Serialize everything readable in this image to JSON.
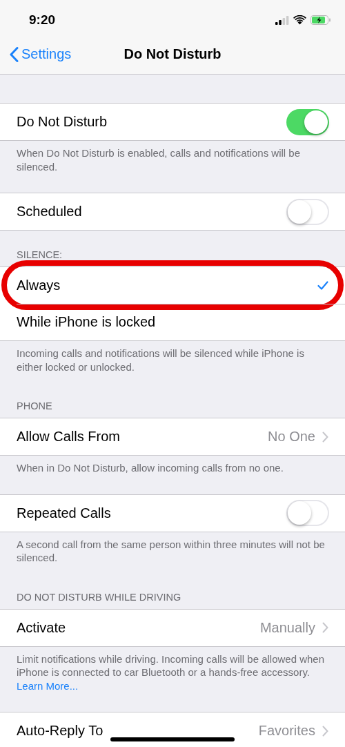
{
  "status_bar": {
    "time": "9:20"
  },
  "nav": {
    "back": "Settings",
    "title": "Do Not Disturb"
  },
  "sections": [
    {
      "rows": [
        {
          "kind": "toggle",
          "label": "Do Not Disturb",
          "on": true
        }
      ],
      "footer": {
        "text": "When Do Not Disturb is enabled, calls and notifications will be silenced."
      }
    },
    {
      "rows": [
        {
          "kind": "toggle",
          "label": "Scheduled",
          "on": false
        }
      ]
    },
    {
      "header": "SILENCE:",
      "rows": [
        {
          "kind": "check",
          "label": "Always",
          "selected": true,
          "highlighted": true
        },
        {
          "kind": "check",
          "label": "While iPhone is locked",
          "selected": false,
          "highlighted": false
        }
      ],
      "footer": {
        "text": "Incoming calls and notifications will be silenced while iPhone is either locked or unlocked."
      }
    },
    {
      "header": "PHONE",
      "rows": [
        {
          "kind": "disclosure",
          "label": "Allow Calls From",
          "value": "No One"
        }
      ],
      "footer": {
        "text": "When in Do Not Disturb, allow incoming calls from no one."
      }
    },
    {
      "rows": [
        {
          "kind": "toggle",
          "label": "Repeated Calls",
          "on": false
        }
      ],
      "footer": {
        "text": "A second call from the same person within three minutes will not be silenced."
      }
    },
    {
      "header": "DO NOT DISTURB WHILE DRIVING",
      "rows": [
        {
          "kind": "disclosure",
          "label": "Activate",
          "value": "Manually"
        }
      ],
      "footer": {
        "text": "Limit notifications while driving. Incoming calls will be allowed when iPhone is connected to car Bluetooth or a hands-free accessory.",
        "link": "Learn More..."
      }
    },
    {
      "rows": [
        {
          "kind": "disclosure",
          "label": "Auto-Reply To",
          "value": "Favorites"
        }
      ]
    }
  ]
}
